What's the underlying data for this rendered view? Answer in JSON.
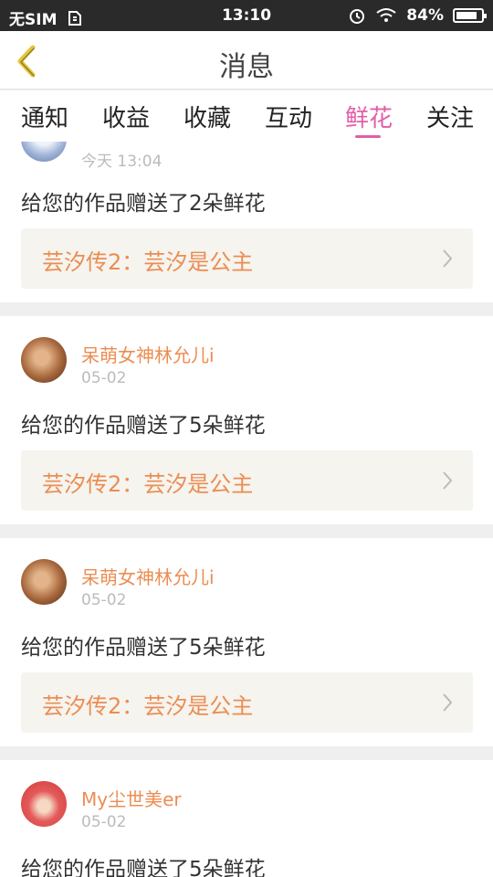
{
  "status": {
    "carrier": "无SIM",
    "sim_icon": "sim-card-icon",
    "time": "13:10",
    "battery": "84%",
    "battery_level": 0.84
  },
  "header": {
    "title": "消息",
    "back_icon": "back-chevron-icon"
  },
  "tabs": [
    {
      "label": "通知"
    },
    {
      "label": "收益"
    },
    {
      "label": "收藏"
    },
    {
      "label": "互动"
    },
    {
      "label": "鲜花"
    },
    {
      "label": "关注"
    }
  ],
  "active_tab": "鲜花",
  "colors": {
    "accent": "#e35ea6",
    "username": "#ec8d52",
    "work_bg": "#f5f4ef"
  },
  "messages": [
    {
      "user": "",
      "time": "今天 13:04",
      "text": "给您的作品赠送了2朵鲜花",
      "work_title": "芸汐传2：芸汐是公主"
    },
    {
      "user": "呆萌女神林允儿i",
      "time": "05-02",
      "text": "给您的作品赠送了5朵鲜花",
      "work_title": "芸汐传2：芸汐是公主"
    },
    {
      "user": "呆萌女神林允儿i",
      "time": "05-02",
      "text": "给您的作品赠送了5朵鲜花",
      "work_title": "芸汐传2：芸汐是公主"
    },
    {
      "user": "My尘世美er",
      "time": "05-02",
      "text": "给您的作品赠送了5朵鲜花",
      "work_title": ""
    }
  ]
}
